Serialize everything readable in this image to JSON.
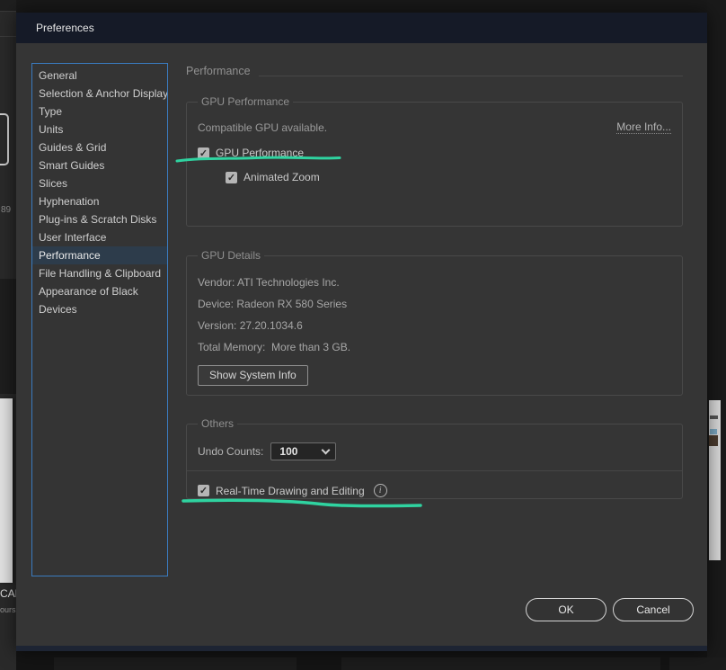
{
  "window": {
    "title": "Preferences"
  },
  "sidebar": {
    "items": [
      {
        "label": "General",
        "selected": false
      },
      {
        "label": "Selection & Anchor Display",
        "selected": false
      },
      {
        "label": "Type",
        "selected": false
      },
      {
        "label": "Units",
        "selected": false
      },
      {
        "label": "Guides & Grid",
        "selected": false
      },
      {
        "label": "Smart Guides",
        "selected": false
      },
      {
        "label": "Slices",
        "selected": false
      },
      {
        "label": "Hyphenation",
        "selected": false
      },
      {
        "label": "Plug-ins & Scratch Disks",
        "selected": false
      },
      {
        "label": "User Interface",
        "selected": false
      },
      {
        "label": "Performance",
        "selected": true
      },
      {
        "label": "File Handling & Clipboard",
        "selected": false
      },
      {
        "label": "Appearance of Black",
        "selected": false
      },
      {
        "label": "Devices",
        "selected": false
      }
    ]
  },
  "content": {
    "heading": "Performance",
    "gpu_performance": {
      "legend": "GPU Performance",
      "status": "Compatible GPU available.",
      "more_info_link": "More Info...",
      "gpu_checkbox": {
        "label": "GPU Performance",
        "checked": true,
        "checkmark": "✓"
      },
      "animated_zoom_checkbox": {
        "label": "Animated Zoom",
        "checked": true,
        "checkmark": "✓"
      }
    },
    "gpu_details": {
      "legend": "GPU Details",
      "vendor": "Vendor: ATI Technologies Inc.",
      "device": "Device: Radeon RX 580 Series",
      "version": "Version: 27.20.1034.6",
      "total_memory": "Total Memory:  More than 3 GB.",
      "show_system_info_button": "Show System Info"
    },
    "others": {
      "legend": "Others",
      "undo_label": "Undo Counts:",
      "undo_value": "100",
      "realtime_checkbox": {
        "label": "Real-Time Drawing and Editing",
        "checked": true,
        "checkmark": "✓"
      },
      "info_icon_glyph": "i"
    }
  },
  "footer": {
    "ok_label": "OK",
    "cancel_label": "Cancel"
  },
  "background": {
    "left_number": "89",
    "left_text_top": "CAR",
    "left_text_bottom": "ours"
  },
  "colors": {
    "annotation_green": "#2fd3a0",
    "sidebar_border_blue": "#3a7bbf",
    "selected_item_bg": "#2d3c4b",
    "titlebar_navy": "#151a27",
    "dialog_bg": "#353535"
  }
}
